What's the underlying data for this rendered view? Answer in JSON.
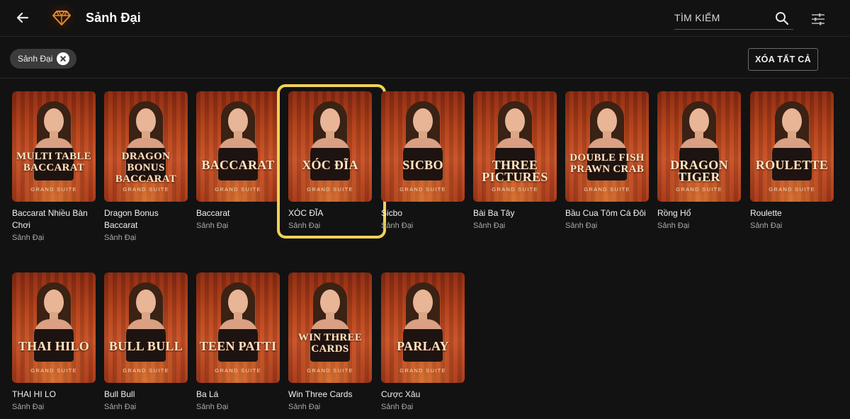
{
  "header": {
    "title": "Sảnh Đại",
    "search_placeholder": "TÌM KIẾM"
  },
  "filter": {
    "chip_label": "Sảnh Đại",
    "clear_all_label": "XÓA TẤT CẢ"
  },
  "thumb_suite_label": "GRAND SUITE",
  "colors": {
    "background": "#121212",
    "chip": "#3b3b3b",
    "selection": "#f2d155",
    "logo_orange": "#f28a1e"
  },
  "icons": {
    "back": "arrow-left-icon",
    "logo": "diamond-icon",
    "search": "search-icon",
    "filter": "sliders-icon",
    "chip_close": "close-circle-icon"
  },
  "games": [
    {
      "thumb_text": "MULTI TABLE BACCARAT",
      "title": "Baccarat Nhiều Bàn Chơi",
      "subtitle": "Sảnh Đại"
    },
    {
      "thumb_text": "DRAGON BONUS BACCARAT",
      "title": "Dragon Bonus Baccarat",
      "subtitle": "Sảnh Đại"
    },
    {
      "thumb_text": "BACCARAT",
      "title": "Baccarat",
      "subtitle": "Sảnh Đại"
    },
    {
      "thumb_text": "XÓC ĐĨA",
      "title": "XÓC ĐĨA",
      "subtitle": "Sảnh Đại",
      "selected": true
    },
    {
      "thumb_text": "SICBO",
      "title": "Sicbo",
      "subtitle": "Sảnh Đại"
    },
    {
      "thumb_text": "THREE PICTURES",
      "title": "Bài Ba Tây",
      "subtitle": "Sảnh Đại"
    },
    {
      "thumb_text": "DOUBLE FISH PRAWN CRAB",
      "title": "Bầu Cua Tôm Cá Đôi",
      "subtitle": "Sảnh Đại"
    },
    {
      "thumb_text": "DRAGON TIGER",
      "title": "Rồng Hổ",
      "subtitle": "Sảnh Đại"
    },
    {
      "thumb_text": "ROULETTE",
      "title": "Roulette",
      "subtitle": "Sảnh Đại"
    },
    {
      "thumb_text": "THAI HILO",
      "title": "THAI HI LO",
      "subtitle": "Sảnh Đại"
    },
    {
      "thumb_text": "BULL BULL",
      "title": "Bull Bull",
      "subtitle": "Sảnh Đại"
    },
    {
      "thumb_text": "TEEN PATTI",
      "title": "Ba Lá",
      "subtitle": "Sảnh Đại"
    },
    {
      "thumb_text": "WIN THREE CARDS",
      "title": "Win Three Cards",
      "subtitle": "Sảnh Đại"
    },
    {
      "thumb_text": "PARLAY",
      "title": "Cược Xâu",
      "subtitle": "Sảnh Đại"
    }
  ]
}
